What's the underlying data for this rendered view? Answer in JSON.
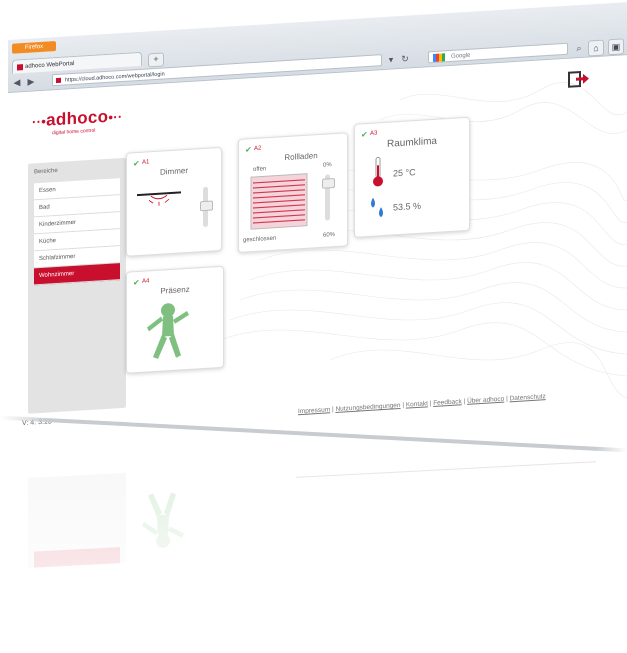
{
  "browser": {
    "firefox_label": "Firefox",
    "tab_title": "adhoco WebPortal",
    "new_tab_symbol": "+",
    "url": "https://cloud.adhoco.com/webportal/login",
    "search_placeholder": "Google",
    "window_controls": [
      "—",
      "▭",
      "✕"
    ]
  },
  "app": {
    "logo_text": "adhoco",
    "tagline": "digital home control",
    "accent_color": "#c8102e"
  },
  "sidebar": {
    "heading": "Bereiche",
    "items": [
      {
        "label": "Essen",
        "active": false
      },
      {
        "label": "Bad",
        "active": false
      },
      {
        "label": "Kinderzimmer",
        "active": false
      },
      {
        "label": "Küche",
        "active": false
      },
      {
        "label": "Schlafzimmer",
        "active": false
      },
      {
        "label": "Wohnzimmer",
        "active": true
      }
    ]
  },
  "version": "V: 4. 3.13",
  "cards": {
    "dimmer": {
      "id": "A1",
      "title": "Dimmer"
    },
    "blinds": {
      "id": "A2",
      "title": "Rollladen",
      "label_open": "offen",
      "pct_top": "0%",
      "label_closed": "geschlossen",
      "pct_bottom": "60%",
      "level": 0.6
    },
    "climate": {
      "id": "A3",
      "title": "Raumklima",
      "temperature": "25 °C",
      "humidity": "53.5 %"
    },
    "presence": {
      "id": "A4",
      "title": "Präsenz"
    }
  },
  "footer": {
    "links": [
      "Impressum",
      "Nutzungsbedingungen",
      "Kontakt",
      "Feedback",
      "Über adhoco",
      "Datenschutz"
    ]
  }
}
